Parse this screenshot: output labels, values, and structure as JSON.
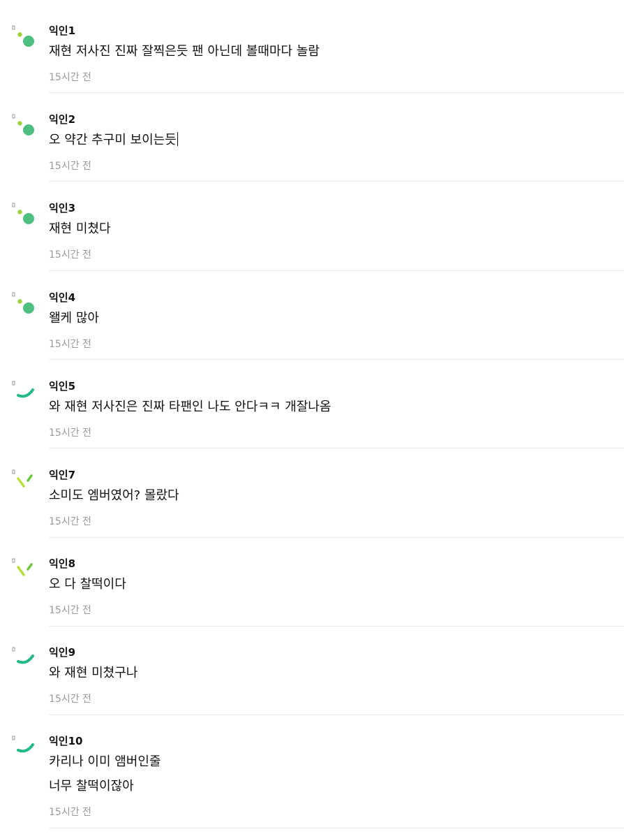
{
  "comments": [
    {
      "nick": "익인1",
      "lines": [
        "재현 저사진 진짜 잘찍은듯 팬 아닌데 볼때마다 놀람"
      ],
      "time": "15시간 전",
      "avatar": "dots-icon"
    },
    {
      "nick": "익인2",
      "lines": [
        "오 약간 추구미 보이는듯"
      ],
      "time": "15시간 전",
      "avatar": "dots-icon",
      "cursor": true
    },
    {
      "nick": "익인3",
      "lines": [
        "재현 미쳤다"
      ],
      "time": "15시간 전",
      "avatar": "dots-icon"
    },
    {
      "nick": "익인4",
      "lines": [
        "왤케 많아"
      ],
      "time": "15시간 전",
      "avatar": "dots-icon"
    },
    {
      "nick": "익인5",
      "lines": [
        "와 재현 저사진은 진짜 타팬인 나도 안다ㅋㅋ 개잘나옴"
      ],
      "time": "15시간 전",
      "avatar": "arc-icon"
    },
    {
      "nick": "익인7",
      "lines": [
        "소미도 엠버였어? 몰랐다"
      ],
      "time": "15시간 전",
      "avatar": "dashes-icon"
    },
    {
      "nick": "익인8",
      "lines": [
        "오 다 찰떡이다"
      ],
      "time": "15시간 전",
      "avatar": "dashes-icon"
    },
    {
      "nick": "익인9",
      "lines": [
        "와 재현 미쳤구나"
      ],
      "time": "15시간 전",
      "avatar": "arc-icon"
    },
    {
      "nick": "익인10",
      "lines": [
        "카리나 이미 앰버인줄",
        "너무 찰떡이잖아"
      ],
      "time": "15시간 전",
      "avatar": "arc-icon"
    }
  ],
  "colors": {
    "dots_small": "#9fd13a",
    "dots_big": "#4fbf7f",
    "arc": "#22b887",
    "dash_a": "#b8dc3c",
    "dash_b": "#6cc83a",
    "time": "#9a9a9a",
    "divider": "#ececec"
  }
}
